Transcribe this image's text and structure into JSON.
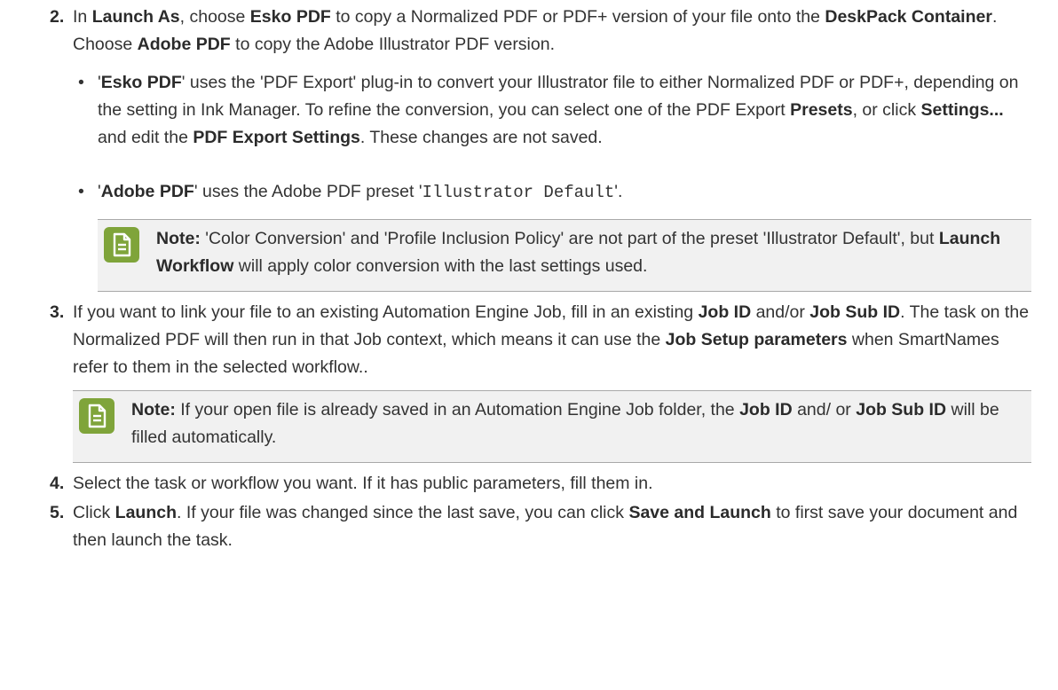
{
  "step2": {
    "number": "2.",
    "t1": "In ",
    "b1": "Launch As",
    "t2": ", choose ",
    "b2": "Esko PDF",
    "t3": " to copy a Normalized PDF or PDF+ version of your file onto the ",
    "b3": "DeskPack Container",
    "t4": ". Choose ",
    "b4": "Adobe PDF",
    "t5": " to copy the Adobe Illustrator PDF version.",
    "bullet1": {
      "q1": "'",
      "b1": "Esko PDF",
      "t1": "' uses the 'PDF Export' plug-in to convert your Illustrator file to either Normalized PDF or PDF+, depending on the setting in Ink Manager. To refine the conversion, you can select one of the PDF Export ",
      "b2": "Presets",
      "t2": ", or click ",
      "b3": "Settings...",
      "t3": " and edit the ",
      "b4": "PDF Export Settings",
      "t4": ". These changes are not saved."
    },
    "bullet2": {
      "q1": "'",
      "b1": "Adobe PDF",
      "t1": "' uses the Adobe PDF preset '",
      "code": "Illustrator Default",
      "t2": "'."
    },
    "note": {
      "label": "Note:",
      "t1": " 'Color Conversion' and 'Profile Inclusion Policy' are not part of the preset 'Illustrator Default', but ",
      "b1": "Launch Workflow",
      "t2": " will apply color conversion with the last settings used."
    }
  },
  "step3": {
    "number": "3.",
    "t1": "If you want to link your file to an existing Automation Engine Job, fill in an existing ",
    "b1": "Job ID",
    "t2": " and/or ",
    "b2": "Job Sub ID",
    "t3": ". The task on the Normalized PDF will then run in that Job context, which means it can use the ",
    "b3": "Job Setup parameters",
    "t4": " when SmartNames refer to them in the selected workflow..",
    "note": {
      "label": "Note:",
      "t1": " If your open file is already saved in an Automation Engine Job folder, the ",
      "b1": "Job ID",
      "t2": " and/ or ",
      "b2": "Job Sub ID",
      "t3": " will be filled automatically."
    }
  },
  "step4": {
    "number": "4.",
    "text": "Select the task or workflow you want. If it has public parameters, fill them in."
  },
  "step5": {
    "number": "5.",
    "t1": "Click ",
    "b1": "Launch",
    "t2": ". If your file was changed since the last save, you can click ",
    "b2": "Save and Launch",
    "t3": " to first save your document and then launch the task."
  },
  "icons": {
    "note_icon": "note-document-icon",
    "note_color": "#7fa43a"
  }
}
